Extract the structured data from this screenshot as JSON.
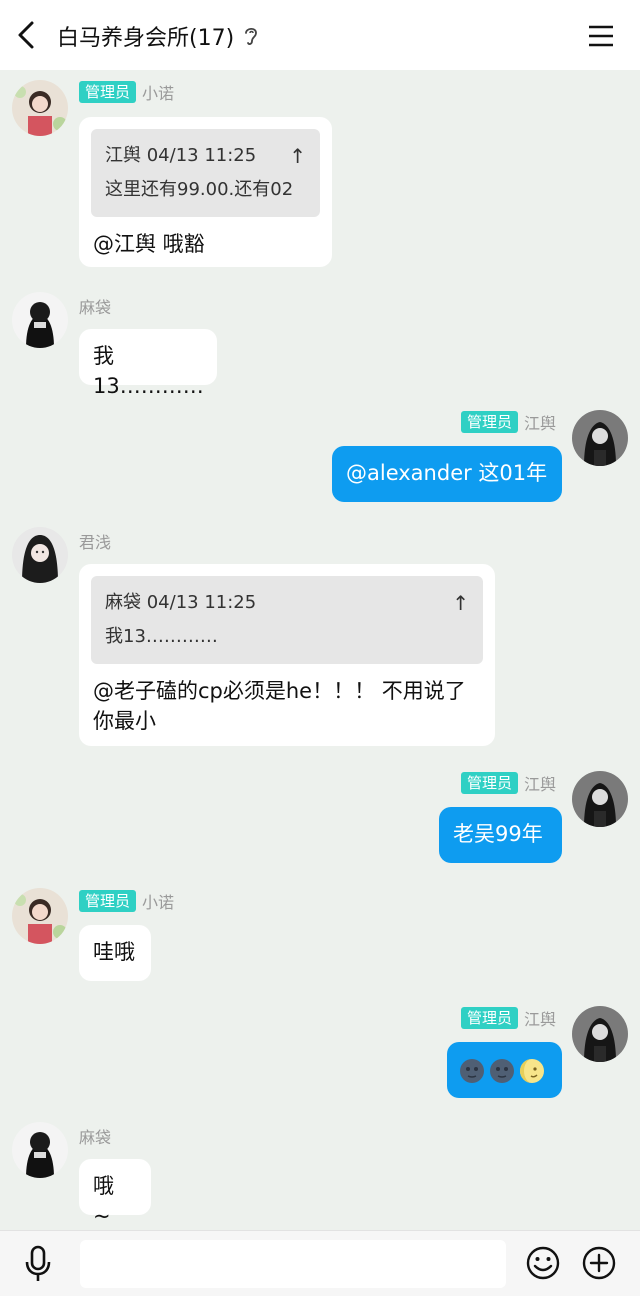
{
  "header": {
    "title": "白马养身会所(17)"
  },
  "messages": [
    {
      "sender": "小诺",
      "badge": "管理员",
      "quote": {
        "author_time": "江舆 04/13 11:25",
        "text": "这里还有99.00.还有02"
      },
      "text": "@江舆 哦豁"
    },
    {
      "sender": "麻袋",
      "text": "我13…………"
    },
    {
      "sender": "江舆",
      "badge": "管理员",
      "text": "@alexander 这01年"
    },
    {
      "sender": "君浅",
      "quote": {
        "author_time": "麻袋 04/13 11:25",
        "text": "我13…………"
      },
      "text": "@老子磕的cp必须是he！！！ 不用说了你最小"
    },
    {
      "sender": "江舆",
      "badge": "管理员",
      "text": "老吴99年"
    },
    {
      "sender": "小诺",
      "badge": "管理员",
      "text": "哇哦"
    },
    {
      "sender": "江舆",
      "badge": "管理员",
      "emojis": [
        "new-moon-face",
        "new-moon-face",
        "first-quarter-moon-face"
      ]
    },
    {
      "sender": "麻袋",
      "text": "哦 ~"
    }
  ],
  "icons": {
    "back": "back-arrow-icon",
    "ear": "ear-icon",
    "menu": "menu-icon",
    "mic": "microphone-icon",
    "emoji": "emoji-icon",
    "plus": "plus-icon"
  },
  "colors": {
    "background": "#edf1ed",
    "my_bubble": "#0e9cf0",
    "badge": "#2fd0c4"
  }
}
